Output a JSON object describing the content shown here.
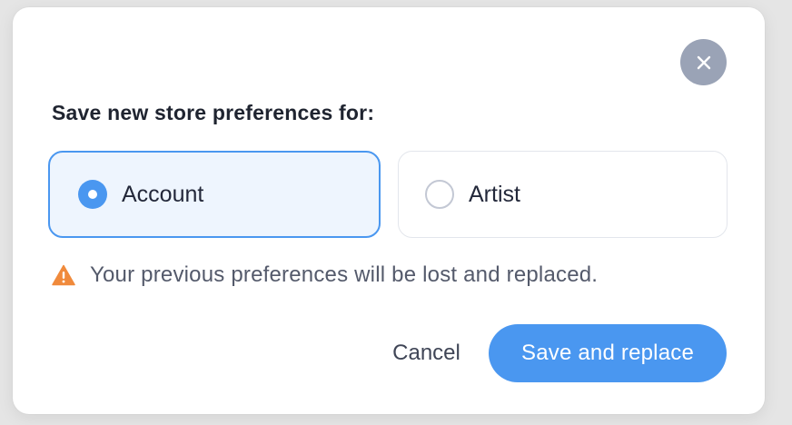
{
  "dialog": {
    "title": "Save new store preferences for:",
    "close_icon": "close-icon",
    "options": [
      {
        "label": "Account",
        "selected": true
      },
      {
        "label": "Artist",
        "selected": false
      }
    ],
    "warning": {
      "icon": "warning-triangle-icon",
      "text": "Your previous preferences will be lost and replaced."
    },
    "actions": {
      "cancel_label": "Cancel",
      "save_label": "Save and replace"
    }
  },
  "colors": {
    "accent": "#4a97f0",
    "selected_bg": "#eef5fe",
    "warning": "#f08a3c",
    "close_button": "#9aa3b6"
  }
}
